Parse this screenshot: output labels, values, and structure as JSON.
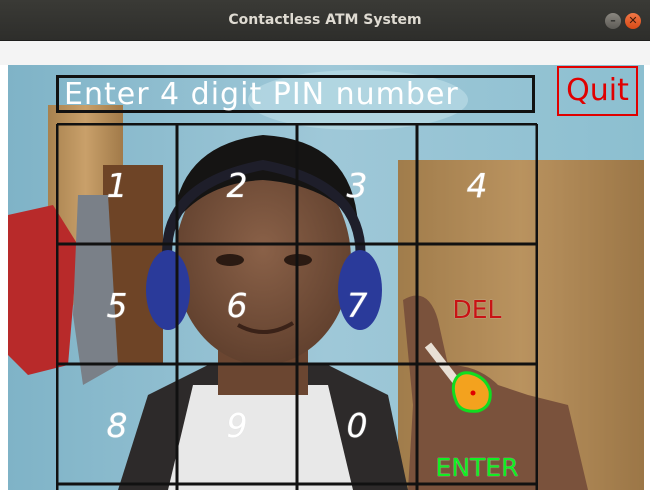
{
  "window": {
    "title": "Contactless ATM System",
    "minimize_glyph": "–",
    "close_glyph": "✕"
  },
  "overlay": {
    "pin_prompt": "Enter 4 digit PIN number",
    "quit_label": "Quit",
    "keys": [
      "1",
      "2",
      "3",
      "4",
      "5",
      "6",
      "7",
      "DEL",
      "8",
      "9",
      "0",
      "ENTER"
    ],
    "colors": {
      "grid": "#111111",
      "digit": "#ffffff",
      "del": "#c81414",
      "enter": "#11ee22",
      "quit": "#e00000",
      "fingertip_marker": "#ffaa00"
    }
  },
  "icons": {
    "minimize": "minimize-icon",
    "close": "close-icon"
  }
}
